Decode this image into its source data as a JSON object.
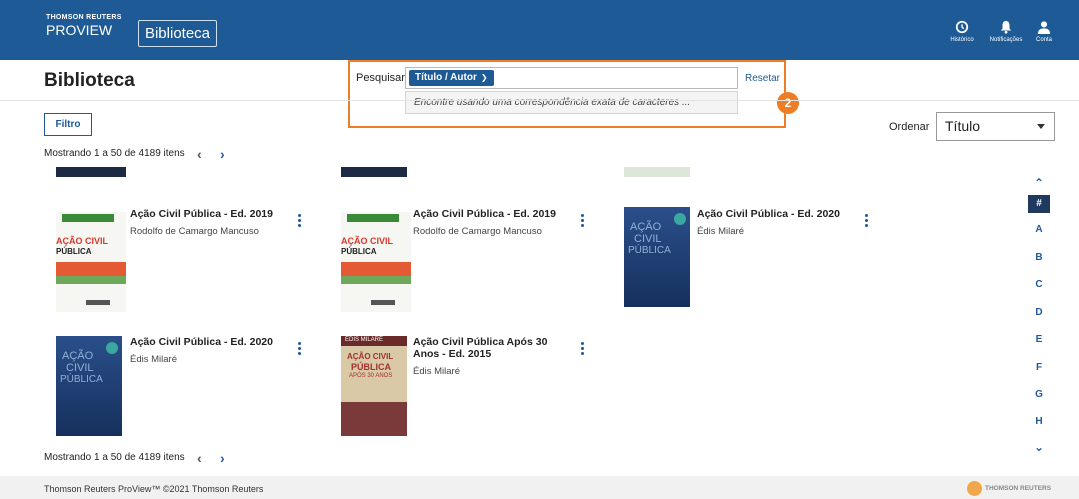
{
  "header": {
    "brand_top": "THOMSON REUTERS",
    "brand_bottom": "PROVIEW",
    "app_button": "Biblioteca",
    "icons": [
      {
        "name": "history-icon",
        "label": "Histórico"
      },
      {
        "name": "bell-icon",
        "label": "Notificações"
      },
      {
        "name": "user-icon",
        "label": "Conta"
      }
    ]
  },
  "page": {
    "title": "Biblioteca"
  },
  "search": {
    "label": "Pesquisar",
    "type_label": "Título / Autor",
    "suggestion": "Encontre usando uma correspondência exata de caracteres ...",
    "reset": "Resetar",
    "callout_number": "2",
    "callout_color": "#ee7d23"
  },
  "filter": {
    "label": "Filtro"
  },
  "sort": {
    "label": "Ordenar",
    "selected": "Título"
  },
  "pagination": {
    "text": "Mostrando 1 a 50 de 4189 itens"
  },
  "books": [
    {
      "title": "Ação Civil Pública - Ed. 2019",
      "author": "Rodolfo de Camargo Mancuso",
      "cover": "green"
    },
    {
      "title": "Ação Civil Pública - Ed. 2019",
      "author": "Rodolfo de Camargo Mancuso",
      "cover": "green"
    },
    {
      "title": "Ação Civil Pública - Ed. 2020",
      "author": "Édis Milaré",
      "cover": "blue"
    },
    {
      "title": "Ação Civil Pública - Ed. 2020",
      "author": "Édis Milaré",
      "cover": "blue"
    },
    {
      "title": "Ação Civil Pública Após 30 Anos - Ed. 2015",
      "author": "Édis Milaré",
      "cover": "red"
    }
  ],
  "covers": {
    "green": {
      "banner": "AÇÃO CIVIL",
      "sub": "PÚBLICA"
    },
    "blue": {
      "l1": "AÇÃO",
      "l2": "CIVIL",
      "l3": "PÚBLICA"
    },
    "red": {
      "tag": "ÉDIS MILARÉ",
      "l1": "AÇÃO CIVIL",
      "l2": "PÚBLICA",
      "l3": "APÓS 30 ANOS"
    }
  },
  "alphabet": {
    "letters": [
      "#",
      "A",
      "B",
      "C",
      "D",
      "E",
      "F",
      "G",
      "H"
    ]
  },
  "footer": {
    "text": "Thomson Reuters ProView™ ©2021 Thomson Reuters",
    "logo_text": "THOMSON REUTERS"
  },
  "colors": {
    "brand": "#1e5a96",
    "accent": "#ee7d23",
    "alpha_active": "#1e3a5e"
  }
}
